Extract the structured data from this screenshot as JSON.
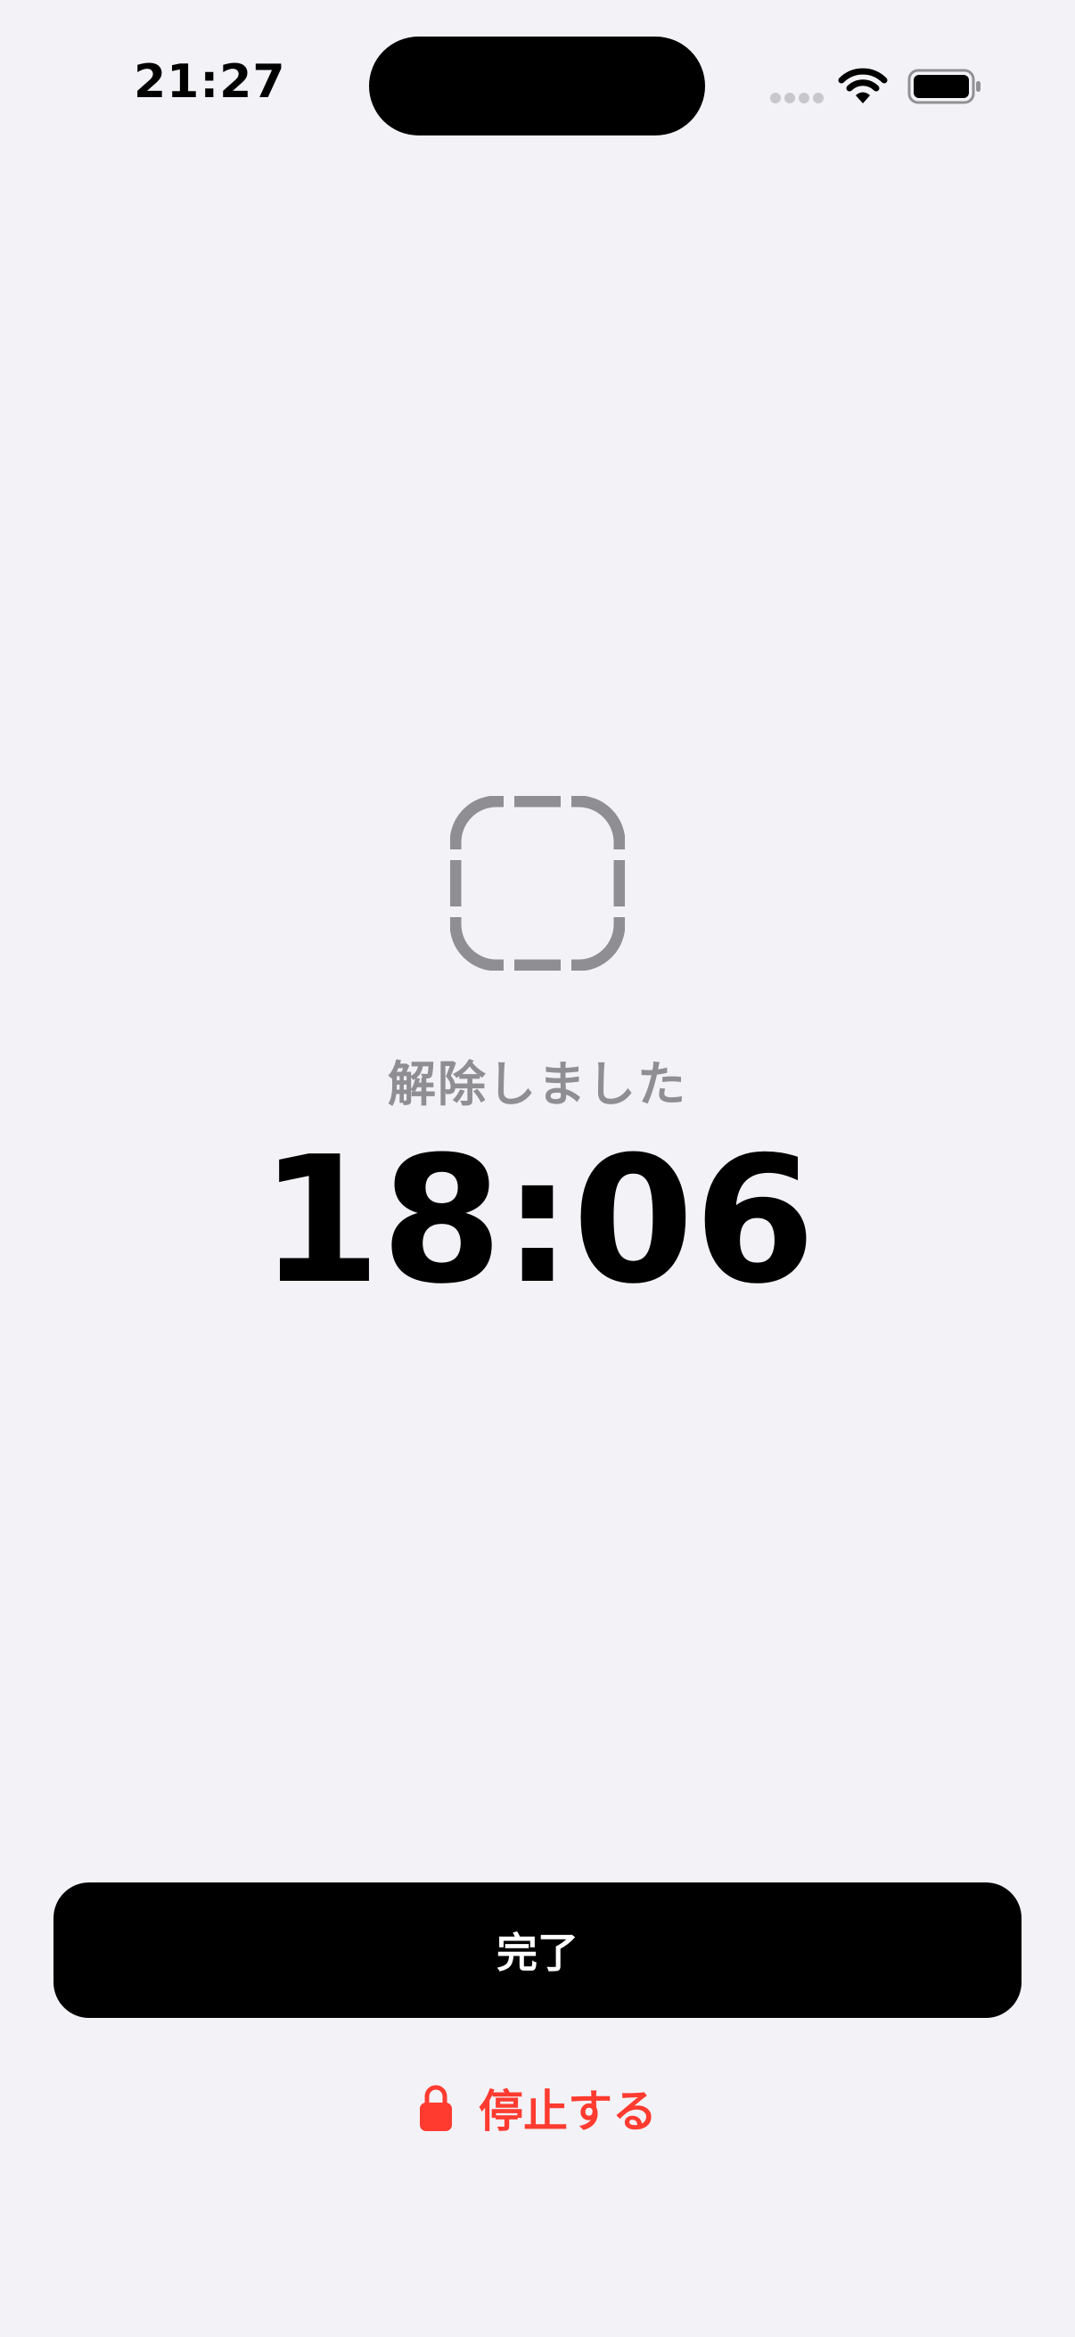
{
  "status_bar": {
    "time": "21:27"
  },
  "icons": {
    "cellular": "cellular-signal-icon",
    "wifi": "wifi-icon",
    "battery": "battery-icon",
    "status": "dashed-square-icon",
    "lock": "lock-icon"
  },
  "main": {
    "status_label": "解除しました",
    "timer_value": "18:06"
  },
  "actions": {
    "done_label": "完了",
    "stop_label": "停止する"
  },
  "colors": {
    "background": "#f2f2f7",
    "primary_button": "#000000",
    "destructive": "#ff3b30",
    "secondary_text": "#8e8e93"
  }
}
